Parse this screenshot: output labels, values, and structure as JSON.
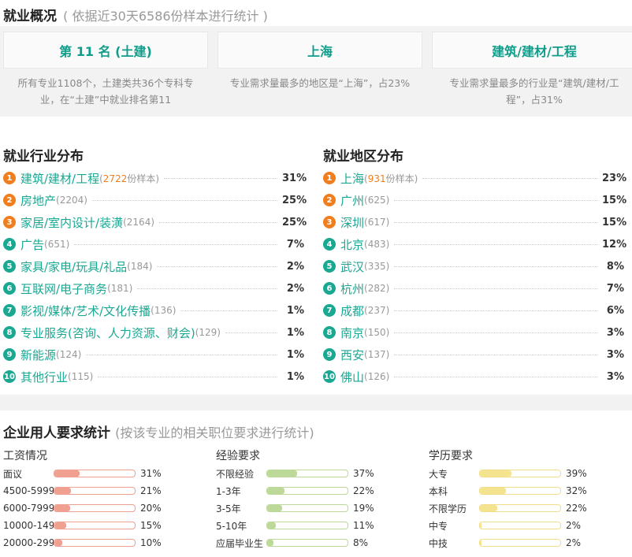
{
  "overview": {
    "title": "就业概况",
    "subtitle": "( 依据近30天6586份样本进行统计 )",
    "cards": [
      {
        "value": "第 11 名 (土建)",
        "desc": "所有专业1108个，土建类共36个专科专业，在“土建”中就业排名第11"
      },
      {
        "value": "上海",
        "desc": "专业需求量最多的地区是“上海”，占23%"
      },
      {
        "value": "建筑/建材/工程",
        "desc": "专业需求量最多的行业是“建筑/建材/工程”，占31%"
      }
    ]
  },
  "industry": {
    "title": "就业行业分布",
    "items": [
      {
        "rank": "1",
        "name": "建筑/建材/工程",
        "count": "2722",
        "suffix": "份样本)",
        "pct": "31%"
      },
      {
        "rank": "2",
        "name": "房地产",
        "count": "(2204)",
        "pct": "25%"
      },
      {
        "rank": "3",
        "name": "家居/室内设计/装潢",
        "count": "(2164)",
        "pct": "25%"
      },
      {
        "rank": "4",
        "name": "广告",
        "count": "(651)",
        "pct": "7%"
      },
      {
        "rank": "5",
        "name": "家具/家电/玩具/礼品",
        "count": "(184)",
        "pct": "2%"
      },
      {
        "rank": "6",
        "name": "互联网/电子商务",
        "count": "(181)",
        "pct": "2%"
      },
      {
        "rank": "7",
        "name": "影视/媒体/艺术/文化传播",
        "count": "(136)",
        "pct": "1%"
      },
      {
        "rank": "8",
        "name": "专业服务(咨询、人力资源、财会)",
        "count": "(129)",
        "pct": "1%"
      },
      {
        "rank": "9",
        "name": "新能源",
        "count": "(124)",
        "pct": "1%"
      },
      {
        "rank": "10",
        "name": "其他行业",
        "count": "(115)",
        "pct": "1%"
      }
    ]
  },
  "region": {
    "title": "就业地区分布",
    "items": [
      {
        "rank": "1",
        "name": "上海",
        "count": "931",
        "suffix": "份样本)",
        "pct": "23%"
      },
      {
        "rank": "2",
        "name": "广州",
        "count": "(625)",
        "pct": "15%"
      },
      {
        "rank": "3",
        "name": "深圳",
        "count": "(617)",
        "pct": "15%"
      },
      {
        "rank": "4",
        "name": "北京",
        "count": "(483)",
        "pct": "12%"
      },
      {
        "rank": "5",
        "name": "武汉",
        "count": "(335)",
        "pct": "8%"
      },
      {
        "rank": "6",
        "name": "杭州",
        "count": "(282)",
        "pct": "7%"
      },
      {
        "rank": "7",
        "name": "成都",
        "count": "(237)",
        "pct": "6%"
      },
      {
        "rank": "8",
        "name": "南京",
        "count": "(150)",
        "pct": "3%"
      },
      {
        "rank": "9",
        "name": "西安",
        "count": "(137)",
        "pct": "3%"
      },
      {
        "rank": "10",
        "name": "佛山",
        "count": "(126)",
        "pct": "3%"
      }
    ]
  },
  "requirements": {
    "title": "企业用人要求统计",
    "subtitle": "(按该专业的相关职位要求进行统计)",
    "columns": [
      {
        "title": "工资情况",
        "bar_color": "#f0a090",
        "fill_color": "#f0a090",
        "rows": [
          {
            "label": "面议",
            "value": 0.31,
            "text": "31%"
          },
          {
            "label": "4500-5999",
            "value": 0.21,
            "text": "21%"
          },
          {
            "label": "6000-7999",
            "value": 0.2,
            "text": "20%"
          },
          {
            "label": "10000-14999",
            "value": 0.15,
            "text": "15%"
          },
          {
            "label": "20000-29999",
            "value": 0.1,
            "text": "10%"
          }
        ]
      },
      {
        "title": "经验要求",
        "bar_color": "#bcd99a",
        "fill_color": "#bcd99a",
        "rows": [
          {
            "label": "不限经验",
            "value": 0.37,
            "text": "37%"
          },
          {
            "label": "1-3年",
            "value": 0.22,
            "text": "22%"
          },
          {
            "label": "3-5年",
            "value": 0.19,
            "text": "19%"
          },
          {
            "label": "5-10年",
            "value": 0.11,
            "text": "11%"
          },
          {
            "label": "应届毕业生",
            "value": 0.08,
            "text": "8%"
          }
        ]
      },
      {
        "title": "学历要求",
        "bar_color": "#f2de8a",
        "fill_color": "#f5e48f",
        "rows": [
          {
            "label": "大专",
            "value": 0.39,
            "text": "39%"
          },
          {
            "label": "本科",
            "value": 0.32,
            "text": "32%"
          },
          {
            "label": "不限学历",
            "value": 0.22,
            "text": "22%"
          },
          {
            "label": "中专",
            "value": 0.02,
            "text": "2%"
          },
          {
            "label": "中技",
            "value": 0.02,
            "text": "2%"
          }
        ]
      }
    ]
  }
}
